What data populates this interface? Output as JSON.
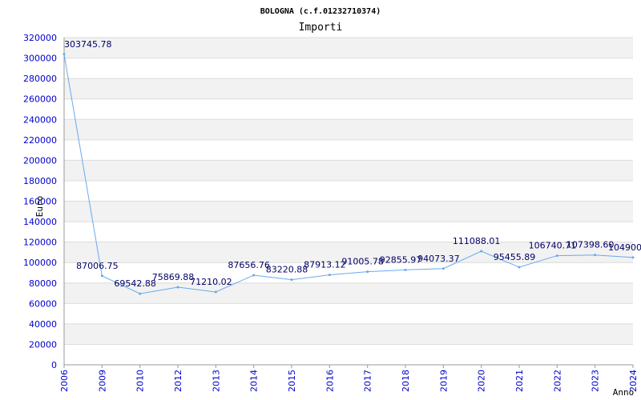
{
  "chart_data": {
    "type": "line",
    "title": "BOLOGNA (c.f.01232710374)",
    "subtitle": "Importi",
    "xlabel": "Anno",
    "ylabel": "Euro",
    "ylim": [
      0,
      320000
    ],
    "yticks": [
      0,
      20000,
      40000,
      60000,
      80000,
      100000,
      120000,
      140000,
      160000,
      180000,
      200000,
      220000,
      240000,
      260000,
      280000,
      300000,
      320000
    ],
    "categories": [
      "2006",
      "2009",
      "2010",
      "2012",
      "2013",
      "2014",
      "2015",
      "2016",
      "2017",
      "2018",
      "2019",
      "2020",
      "2021",
      "2022",
      "2023",
      "2024"
    ],
    "values": [
      303745.78,
      87006.75,
      69542.88,
      75869.88,
      71210.02,
      87656.76,
      83220.88,
      87913.12,
      91005.78,
      92855.97,
      94073.37,
      111088.01,
      95455.89,
      106740.71,
      107398.6,
      104900
    ],
    "value_labels": [
      "303745.78",
      "87006.75",
      "69542.88",
      "75869.88",
      "71210.02",
      "87656.76",
      "83220.88",
      "87913.12",
      "91005.78",
      "92855.97",
      "94073.37",
      "111088.01",
      "95455.89",
      "106740.71",
      "107398.60",
      "104900"
    ],
    "grid": true,
    "colors": {
      "line": "#66aaee",
      "ticks": "#0000cc",
      "labels": "#000066",
      "band": "#f2f2f2"
    }
  }
}
